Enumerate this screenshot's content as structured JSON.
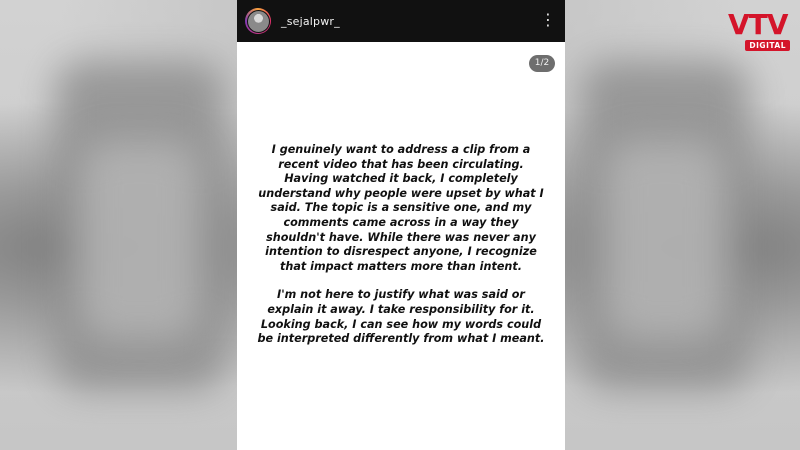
{
  "story": {
    "username": "_sejalpwr_",
    "slide_counter": "1/2",
    "paragraphs": [
      "I genuinely want to address a clip from a recent video that has been circulating. Having watched it back, I completely understand why people were upset by what I said. The topic is a sensitive one, and my comments came across in a way they shouldn't have. While there was never any intention to disrespect anyone, I recognize that impact matters more than intent.",
      "I'm not here to justify what was said or explain it away. I take responsibility for it. Looking back, I can see how my words could be interpreted differently from what I meant."
    ],
    "more_icon": "more-dots-icon"
  },
  "watermark": {
    "brand": "VTV",
    "sub": "DIGITAL",
    "color": "#d4142a"
  }
}
